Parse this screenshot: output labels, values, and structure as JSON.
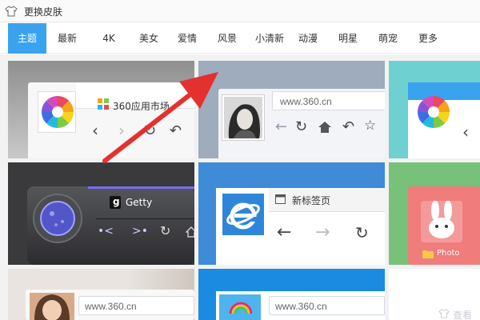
{
  "window": {
    "title": "更换皮肤",
    "icon": "tshirt-icon"
  },
  "tabs": [
    {
      "label": "主题",
      "active": true
    },
    {
      "label": "最新"
    },
    {
      "label": "4K"
    },
    {
      "label": "美女"
    },
    {
      "label": "爱情"
    },
    {
      "label": "风景"
    },
    {
      "label": "小清新"
    },
    {
      "label": "动漫"
    },
    {
      "label": "明星"
    },
    {
      "label": "萌宠"
    },
    {
      "label": "更多"
    }
  ],
  "skins": {
    "appstore": {
      "label": "360应用市场"
    },
    "portrait": {
      "url": "www.360.cn"
    },
    "getty": {
      "label": "Getty",
      "letter": "g"
    },
    "newtab": {
      "label": "新标签页"
    },
    "photo": {
      "label": "Photo"
    },
    "girl": {
      "url": "www.360.cn"
    },
    "blue": {
      "url": "www.360.cn"
    },
    "loading": {
      "label": "查看"
    }
  },
  "colors": {
    "accent": "#3aa3f0",
    "annotation_arrow": "#e53030"
  }
}
